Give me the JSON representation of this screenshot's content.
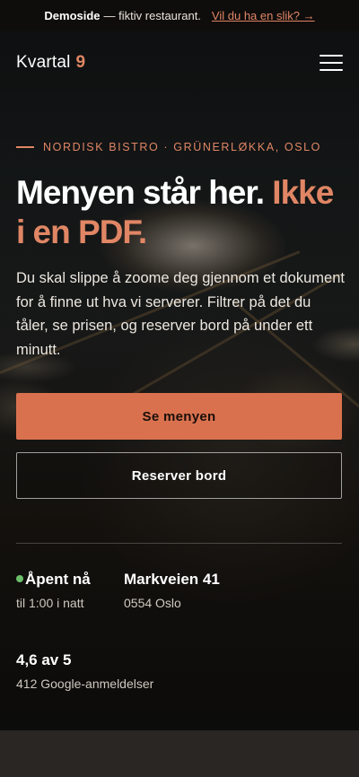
{
  "topbar": {
    "brand": "Demoside",
    "note": "— fiktiv restaurant.",
    "link": "Vil du ha en slik? →"
  },
  "header": {
    "logo_name": "Kvartal",
    "logo_number": "9",
    "menu_icon": "hamburger-menu-icon"
  },
  "hero": {
    "eyebrow": "NORDISK BISTRO · GRÜNERLØKKA, OSLO",
    "title_main": "Menyen står her.",
    "title_accent": "Ikke i en PDF.",
    "lede": "Du skal slippe å zoome deg gjennom et dokument for å finne ut hva vi serverer. Filtrer på det du tåler, se prisen, og reserver bord på under ett minutt.",
    "primary_button": "Se menyen",
    "secondary_button": "Reserver bord"
  },
  "info": {
    "open_title": "Åpent nå",
    "open_sub": "til 1:00 i natt",
    "address_title": "Markveien 41",
    "address_sub": "0554 Oslo",
    "rating_title": "4,6 av 5",
    "rating_sub": "412 Google-anmeldelser"
  },
  "colors": {
    "accent": "#e08665",
    "button": "#d9714e",
    "open_status": "#6bbf6a"
  }
}
